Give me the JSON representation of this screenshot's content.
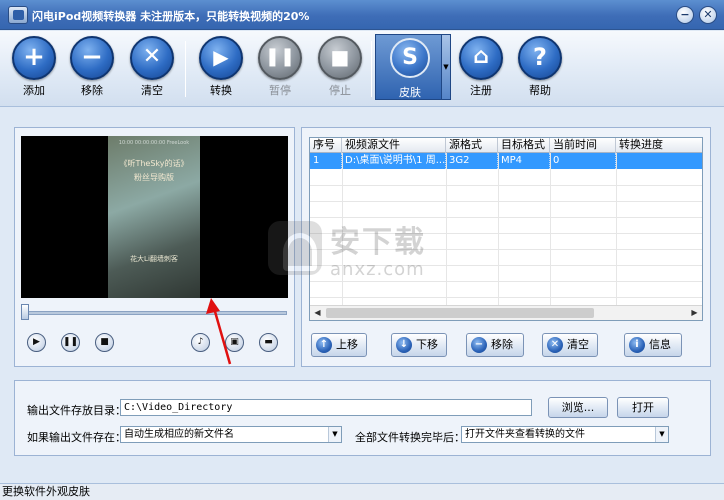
{
  "window": {
    "title": "闪电iPod视频转换器   未注册版本，只能转换视频的20%",
    "minimize_glyph": "−",
    "close_glyph": "✕"
  },
  "toolbar": {
    "add": "添加",
    "remove": "移除",
    "clear": "清空",
    "convert": "转换",
    "pause": "暂停",
    "stop": "停止",
    "skin": "皮肤",
    "register": "注册",
    "help": "帮助"
  },
  "preview": {
    "video_lines": [
      "《听TheSky的话》",
      "粉丝导购版",
      "花大Li翻墙刺客"
    ],
    "video_small": "10:00 00:00:00:00 FreeLook",
    "progress": 0.0
  },
  "file_table": {
    "columns": [
      "序号",
      "视频源文件",
      "源格式",
      "目标格式",
      "当前时间",
      "转换进度"
    ],
    "rows": [
      {
        "index": "1",
        "source": "D:\\桌面\\说明书\\1 周...",
        "src_format": "3G2",
        "dst_format": "MP4",
        "current_time": "0",
        "progress": ""
      }
    ]
  },
  "list_buttons": {
    "move_up": "上移",
    "move_down": "下移",
    "remove": "移除",
    "clear": "清空",
    "info": "信息"
  },
  "output": {
    "dir_label": "输出文件存放目录：",
    "dir_value": "C:\\Video_Directory",
    "browse": "浏览...",
    "open": "打开",
    "exists_label": "如果输出文件存在：",
    "exists_value": "自动生成相应的新文件名",
    "after_label": "全部文件转换完毕后：",
    "after_value": "打开文件夹查看转换的文件"
  },
  "status": {
    "text": "更换软件外观皮肤"
  },
  "watermark": {
    "main": "安下载",
    "sub": "anxz.com"
  }
}
